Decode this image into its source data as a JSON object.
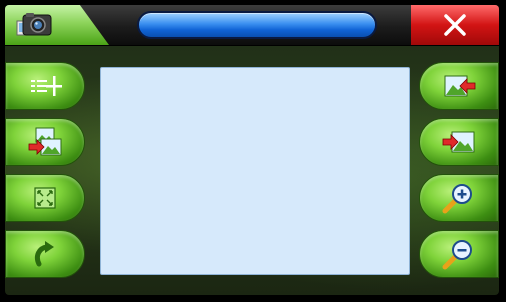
{
  "window": {
    "title": "",
    "app_icon": "camera-photos-icon",
    "close_icon": "close-x-icon"
  },
  "left_toolbar": [
    {
      "name": "add-list-button",
      "icon": "list-plus-icon"
    },
    {
      "name": "image-import-button",
      "icon": "image-arrow-in-icon"
    },
    {
      "name": "fit-screen-button",
      "icon": "fit-screen-icon"
    },
    {
      "name": "rotate-button",
      "icon": "rotate-arrow-icon"
    }
  ],
  "right_toolbar": [
    {
      "name": "previous-image-button",
      "icon": "image-arrow-left-icon"
    },
    {
      "name": "next-image-button",
      "icon": "image-arrow-right-icon"
    },
    {
      "name": "zoom-in-button",
      "icon": "magnifier-plus-icon"
    },
    {
      "name": "zoom-out-button",
      "icon": "magnifier-minus-icon"
    }
  ],
  "colors": {
    "accent_green": "#7fd33a",
    "title_blue": "#1164d6",
    "close_red": "#d21414",
    "content_bg": "#d6e9fb"
  }
}
